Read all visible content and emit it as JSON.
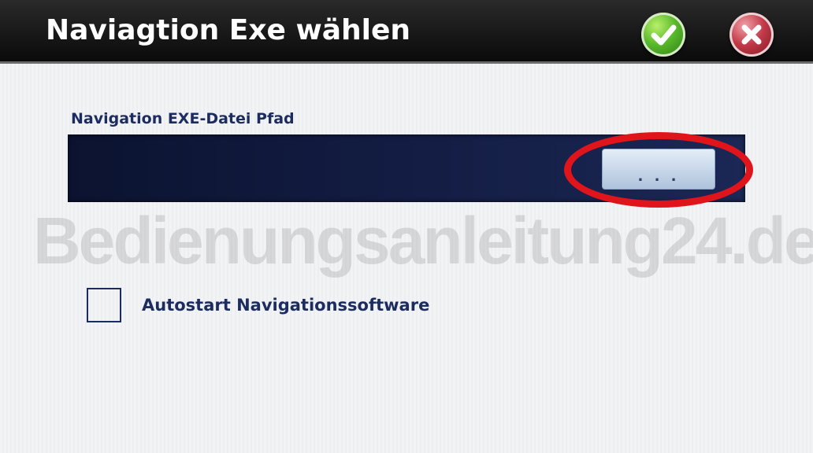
{
  "dialog": {
    "title": "Naviagtion Exe wählen",
    "ok_icon": "checkmark-icon",
    "cancel_icon": "close-icon"
  },
  "path_section": {
    "label": "Navigation EXE-Datei Pfad",
    "value": "",
    "browse_label": ". . ."
  },
  "watermark": "Bedienungsanleitung24.de",
  "autostart": {
    "label": "Autostart Navigationssoftware",
    "checked": false
  },
  "colors": {
    "title_bar": "#111111",
    "field_background": "#141e45",
    "label_text": "#1d2c5e",
    "highlight": "#e0151c",
    "ok": "#58b82a",
    "cancel": "#c23a48"
  }
}
